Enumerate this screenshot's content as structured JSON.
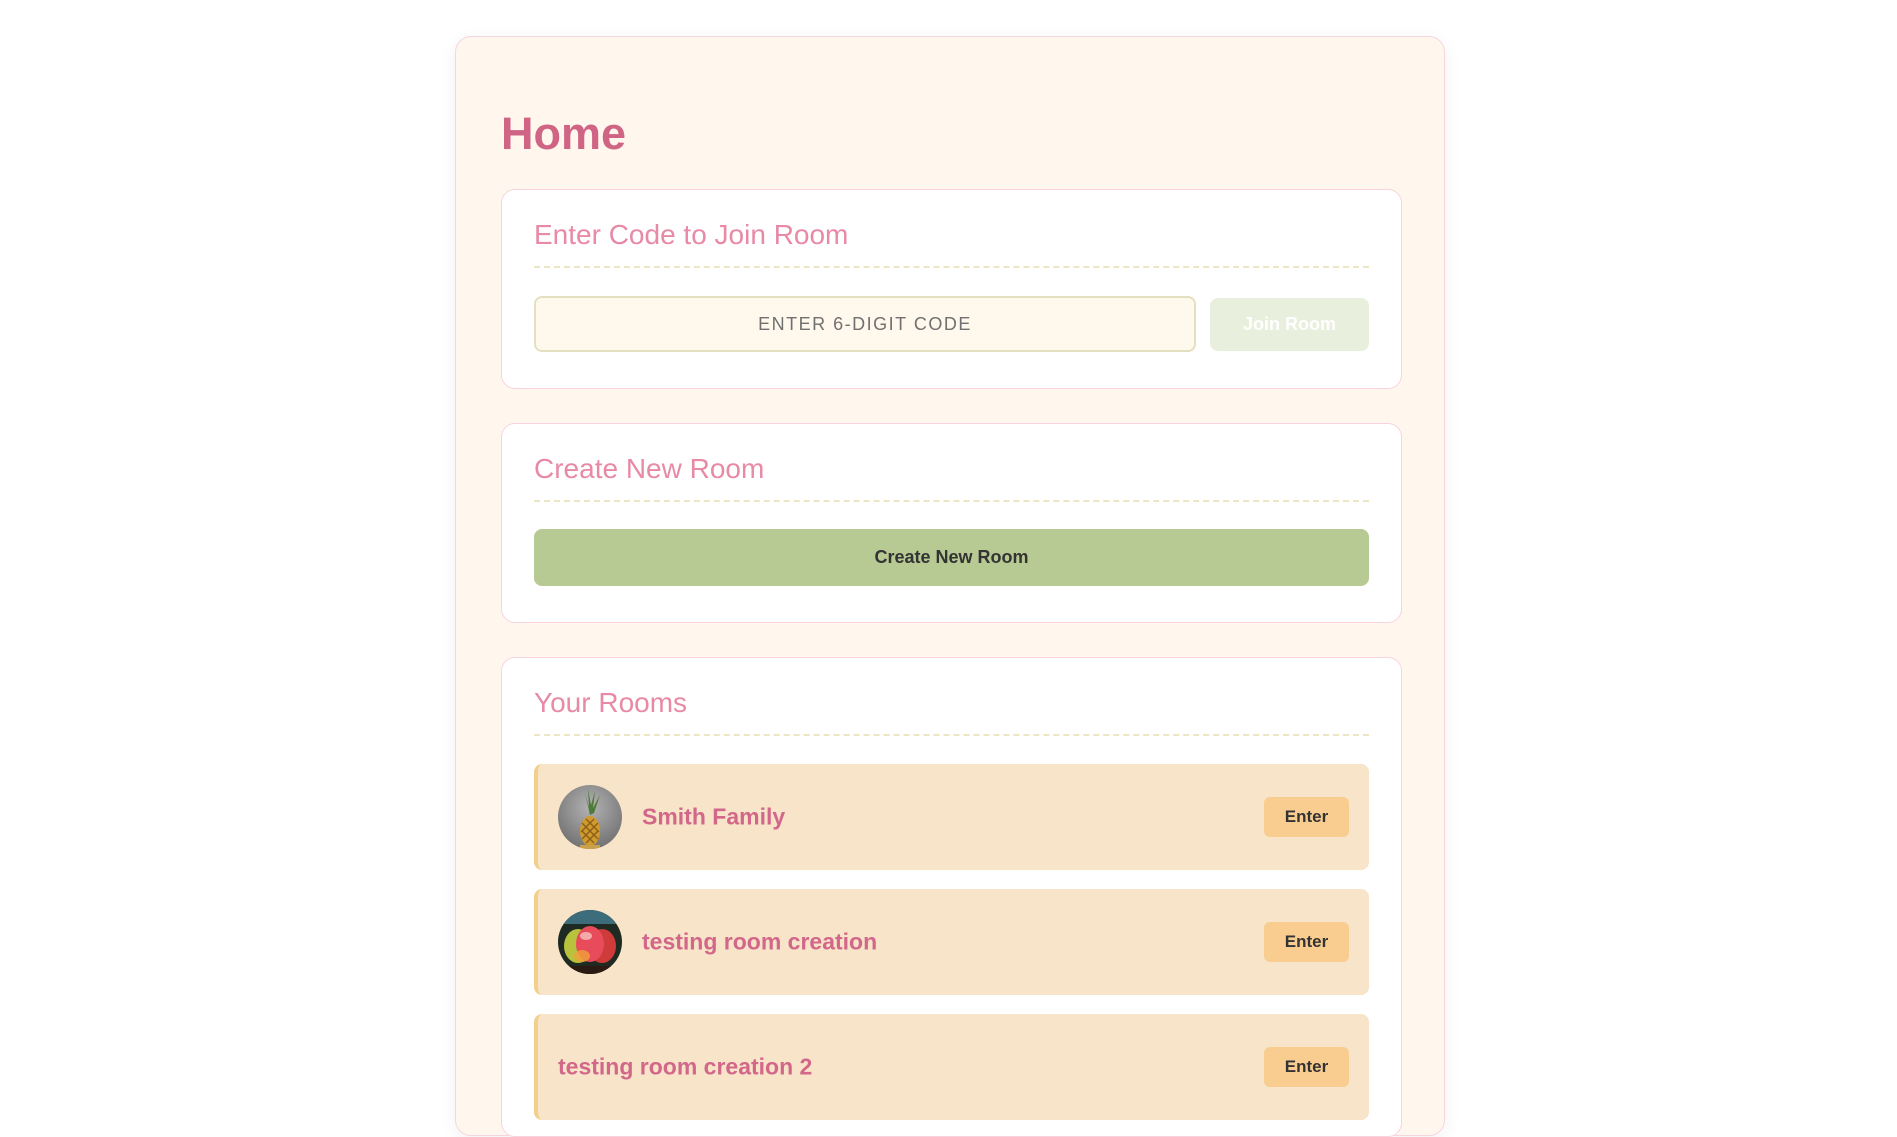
{
  "page": {
    "title": "Home"
  },
  "join_section": {
    "title": "Enter Code to Join Room",
    "input_placeholder": "ENTER 6-DIGIT CODE",
    "input_value": "",
    "join_label": "Join Room"
  },
  "create_section": {
    "title": "Create New Room",
    "create_label": "Create New Room"
  },
  "rooms_section": {
    "title": "Your Rooms",
    "rooms": [
      {
        "name": "Smith Family",
        "avatar": "pineapple-photo",
        "enter_label": "Enter"
      },
      {
        "name": "testing room creation",
        "avatar": "mango-photo",
        "enter_label": "Enter"
      },
      {
        "name": "testing room creation 2",
        "avatar": "",
        "enter_label": "Enter"
      }
    ]
  },
  "colors": {
    "accent_pink": "#cf6485",
    "card_title_pink": "#e88aa6",
    "green_button": "#b8ca93",
    "room_background": "#f7e4c9",
    "enter_button": "#f9cd8f",
    "page_background": "#fff7ee"
  }
}
